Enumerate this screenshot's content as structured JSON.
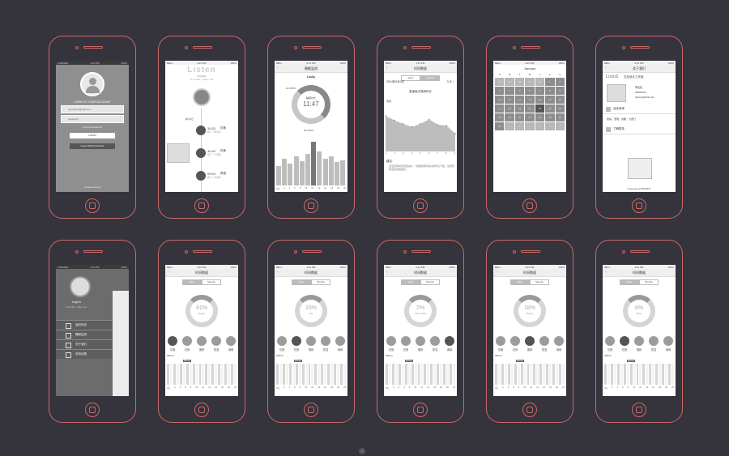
{
  "status": {
    "carrier": "BELL",
    "time": "4:21 PM",
    "battery": "100%",
    "carrier_dark": "CARRIER"
  },
  "login": {
    "title": "LOGIN TO YOUR ACCOUNT",
    "email_placeholder": "username@mail.com",
    "password_placeholder": "password",
    "forgot": "Forgot Password?",
    "login_button": "LOGIN",
    "facebook_button": "Log In With Facebook",
    "create": "Create Account"
  },
  "timeline": {
    "logo": "Listen",
    "name": "Angela",
    "subtitle": "8 months · Tokyo Ltd",
    "marker": "4月18日",
    "events": [
      {
        "time": "11:03",
        "label": "饮食",
        "note": "喝了一杯牛奶"
      },
      {
        "time": "10:42",
        "label": "饮食",
        "note": "吃了一个苹果"
      },
      {
        "time": "09:03",
        "label": "尿湿",
        "note": "换了一次尿布"
      }
    ]
  },
  "sleep": {
    "title": "睡眠监测",
    "mascot": "Lucky",
    "start": "10:25PM",
    "center_label": "睡眠时长",
    "center_value": "11:47",
    "end": "06:30AM",
    "bars": [
      40,
      55,
      45,
      60,
      50,
      65,
      90,
      70,
      55,
      60,
      48,
      52
    ],
    "axis": [
      "0点",
      "2",
      "4",
      "6",
      "8",
      "10",
      "12",
      "14",
      "16",
      "18",
      "20",
      "22"
    ]
  },
  "timedata": {
    "title": "时间数据",
    "tabs": [
      "Days",
      "Months"
    ],
    "date": "2014年5月4日",
    "today": "今天 >",
    "chart_title": "宝宝每天哭闹时长",
    "label_a": "哭闹",
    "label_b": "10分钟",
    "points": [
      80,
      70,
      62,
      55,
      62,
      72,
      60,
      58,
      40
    ],
    "axis": [
      "1",
      "2",
      "3",
      "4",
      "5",
      "6",
      "7",
      "8",
      "9"
    ],
    "suggest_title": "建议:",
    "suggest_text": "宝宝哭闹时长逐渐减少，请继续保持良好的作息习惯，注意观察宝宝情绪变化。"
  },
  "calendar": {
    "month": "January",
    "weekdays": [
      "S",
      "M",
      "T",
      "W",
      "T",
      "F",
      "S"
    ],
    "days": [
      "26",
      "27",
      "28",
      "29",
      "30",
      "1",
      "2",
      "3",
      "4",
      "5",
      "6",
      "7",
      "8",
      "9",
      "10",
      "11",
      "12",
      "13",
      "14",
      "15",
      "16",
      "17",
      "18",
      "19",
      "20",
      "21",
      "22",
      "23",
      "24",
      "25",
      "26",
      "27",
      "28",
      "29",
      "30",
      "31",
      "1",
      "2",
      "3",
      "4",
      "5",
      "6"
    ],
    "selected": "21"
  },
  "about": {
    "title": "关于我们",
    "logo": "ListoS",
    "studio": "交互设计工作室",
    "contact_name": "李佳佳",
    "phone": "43600729",
    "email": "lyzbsm@163.com",
    "section1": "活动老师",
    "members": "张某、安瑞、刘鹏、大西门",
    "section2": "了解更多",
    "url": "Listwang.net/3994637"
  },
  "menu": {
    "name": "Angela",
    "subtitle": "8 months · Tokyo Ltd",
    "items": [
      "返回状态",
      "睡眠监测",
      "关于我们",
      "系统设置"
    ]
  },
  "stats": [
    {
      "title": "时间数据",
      "percent": "41%",
      "label": "Hunger",
      "highlight": 0
    },
    {
      "title": "时间数据",
      "percent": "33%",
      "label": "Wet",
      "highlight": 1
    },
    {
      "title": "时间数据",
      "percent": "2%",
      "label": "Inflammation",
      "highlight": 4
    },
    {
      "title": "时间数据",
      "percent": "18%",
      "label": "Playing",
      "highlight": 2
    },
    {
      "title": "时间数据",
      "percent": "6%",
      "label": "Sleep",
      "highlight": 1
    }
  ],
  "stat_icons": [
    "饥饿",
    "饮食",
    "撒娇",
    "尿湿",
    "病痛"
  ],
  "stat_tag": "Minute",
  "stat_section": "MENU",
  "stat_axis": [
    "0点",
    "2",
    "4",
    "6",
    "8",
    "10",
    "12",
    "14",
    "16",
    "18",
    "20",
    "22"
  ],
  "footer": "UI"
}
